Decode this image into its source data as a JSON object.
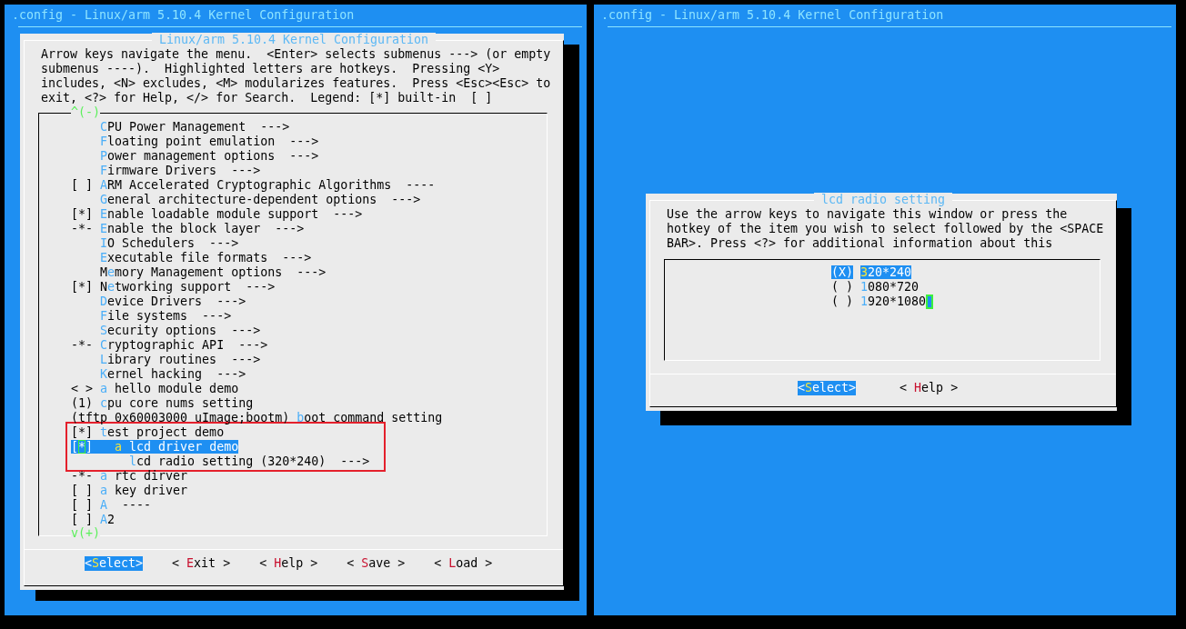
{
  "menu_window": {
    "title": ".config - Linux/arm 5.10.4 Kernel Configuration",
    "dialog_title": "Linux/arm 5.10.4 Kernel Configuration",
    "help_lines": [
      "Arrow keys navigate the menu.  <Enter> selects submenus ---> (or empty",
      "submenus ----).  Highlighted letters are hotkeys.  Pressing <Y>",
      "includes, <N> excludes, <M> modularizes features.  Press <Esc><Esc> to",
      "exit, <?> for Help, </> for Search.  Legend: [*] built-in  [ ]"
    ],
    "scroll_up": "^(-)",
    "scroll_down": "v(+)",
    "items": [
      {
        "label": "**C**PU Power Management  --->",
        "selected": false,
        "annotated": false
      },
      {
        "label": "**F**loating point emulation  --->",
        "selected": false,
        "annotated": false
      },
      {
        "label": "**P**ower management options  --->",
        "selected": false,
        "annotated": false
      },
      {
        "label": "**F**irmware Drivers  --->",
        "selected": false,
        "annotated": false
      },
      {
        "prefix": "[ ]",
        "label": "**A**RM Accelerated Cryptographic Algorithms  ----",
        "selected": false,
        "annotated": false
      },
      {
        "label": "**G**eneral architecture-dependent options  --->",
        "selected": false,
        "annotated": false
      },
      {
        "prefix": "[*]",
        "label": "**E**nable loadable module support  --->",
        "selected": false,
        "annotated": false
      },
      {
        "prefix": "-*-",
        "label": "**E**nable the block layer  --->",
        "selected": false,
        "annotated": false
      },
      {
        "label": "**I**O Schedulers  --->",
        "selected": false,
        "annotated": false
      },
      {
        "label": "**E**xecutable file formats  --->",
        "selected": false,
        "annotated": false
      },
      {
        "label": "M**e**mory Management options  --->",
        "selected": false,
        "annotated": false
      },
      {
        "prefix": "[*]",
        "label": "N**e**tworking support  --->",
        "selected": false,
        "annotated": false
      },
      {
        "label": "**D**evice Drivers  --->",
        "selected": false,
        "annotated": false
      },
      {
        "label": "**F**ile systems  --->",
        "selected": false,
        "annotated": false
      },
      {
        "label": "**S**ecurity options  --->",
        "selected": false,
        "annotated": false
      },
      {
        "prefix": "-*-",
        "label": "**C**ryptographic API  --->",
        "selected": false,
        "annotated": false
      },
      {
        "label": "**L**ibrary routines  --->",
        "selected": false,
        "annotated": false
      },
      {
        "label": "**K**ernel hacking  --->",
        "selected": false,
        "annotated": false
      },
      {
        "prefix": "< >",
        "label": "**a** hello module demo",
        "selected": false,
        "annotated": false
      },
      {
        "prefix": "(1)",
        "label": "**c**pu core nums setting",
        "selected": false,
        "annotated": false
      },
      {
        "prefix": "(tftp 0x60003000 uImage;bootm)",
        "label": "**b**oot command setting",
        "selected": false,
        "annotated": false
      },
      {
        "prefix": "[*]",
        "label": "**t**est project demo",
        "selected": false,
        "annotated": true,
        "children": [
          {
            "prefix": "[*]",
            "label": "**a** lcd driver demo",
            "selected": true,
            "annotated": false,
            "children": [
              {
                "label": "**l**cd radio setting (320*240)  --->",
                "selected": false,
                "annotated": false
              }
            ]
          }
        ]
      },
      {
        "prefix": "-*-",
        "label": "**a** rtc dirver",
        "selected": false,
        "annotated": false
      },
      {
        "prefix": "[ ]",
        "label": "**a** key driver",
        "selected": false,
        "annotated": false
      },
      {
        "prefix": "[ ]",
        "label": "**A**  ----",
        "selected": false,
        "annotated": false
      },
      {
        "prefix": "[ ]",
        "label": "**A**2",
        "selected": false,
        "annotated": false
      }
    ],
    "buttons": [
      {
        "label": "<**S**elect>",
        "selected": true
      },
      {
        "label": "< **E**xit >",
        "selected": false
      },
      {
        "label": "< **H**elp >",
        "selected": false
      },
      {
        "label": "< **S**ave >",
        "selected": false
      },
      {
        "label": "< **L**oad >",
        "selected": false
      }
    ]
  },
  "radio_window": {
    "title": ".config - Linux/arm 5.10.4 Kernel Configuration",
    "dialog_title": "lcd radio setting",
    "help_lines": [
      "Use the arrow keys to navigate this window or press the",
      "hotkey of the item you wish to select followed by the <SPACE",
      "BAR>. Press <?> for additional information about this"
    ],
    "options": [
      {
        "mark": "(X)",
        "label": "**3**20*240",
        "selected": true,
        "cursor": false
      },
      {
        "mark": "( )",
        "label": "**1**080*720",
        "selected": false,
        "cursor": false
      },
      {
        "mark": "( )",
        "label": "**1**920*1080",
        "selected": false,
        "cursor": true
      }
    ],
    "buttons": [
      {
        "label": "<**S**elect>",
        "selected": true
      },
      {
        "label": "< **H**elp >",
        "selected": false
      }
    ]
  }
}
